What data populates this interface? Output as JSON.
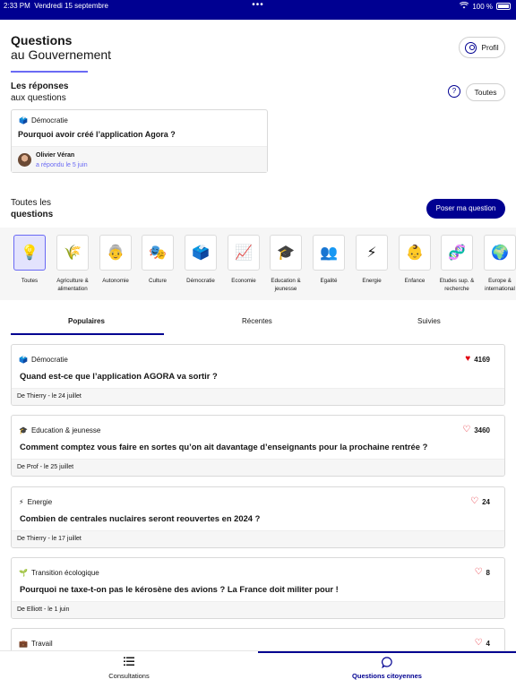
{
  "status_bar": {
    "time": "2:33 PM",
    "date": "Vendredi 15 septembre",
    "dots": "•••",
    "battery": "100 %"
  },
  "header": {
    "title_line1": "Questions",
    "title_line2": "au Gouvernement",
    "profile_label": "Profil"
  },
  "responses": {
    "title_line1": "Les réponses",
    "title_line2": "aux questions",
    "all_label": "Toutes",
    "card": {
      "category_icon": "🗳️",
      "category": "Démocratie",
      "question": "Pourquoi avoir créé l’application Agora ?",
      "author": "Olivier Véran",
      "answered": "a répondu le 5 juin"
    }
  },
  "questions_section": {
    "title_line1": "Toutes les",
    "title_line2": "questions",
    "ask_button": "Poser ma question"
  },
  "categories": [
    {
      "icon": "💡",
      "label": "Toutes"
    },
    {
      "icon": "🌾",
      "label": "Agriculture & alimentation"
    },
    {
      "icon": "👵",
      "label": "Autonomie"
    },
    {
      "icon": "🎭",
      "label": "Culture"
    },
    {
      "icon": "🗳️",
      "label": "Démocratie"
    },
    {
      "icon": "📈",
      "label": "Economie"
    },
    {
      "icon": "🎓",
      "label": "Education & jeunesse"
    },
    {
      "icon": "👥",
      "label": "Egalité"
    },
    {
      "icon": "⚡",
      "label": "Energie"
    },
    {
      "icon": "👶",
      "label": "Enfance"
    },
    {
      "icon": "🧬",
      "label": "Etudes sup. & recherche"
    },
    {
      "icon": "🌍",
      "label": "Europe & international"
    }
  ],
  "tabs": {
    "popular": "Populaires",
    "recent": "Récentes",
    "followed": "Suivies"
  },
  "questions": [
    {
      "icon": "🗳️",
      "category": "Démocratie",
      "likes": "4169",
      "liked": true,
      "question": "Quand est-ce que l’application AGORA va sortir ?",
      "footer": "De Thierry - le 24 juillet"
    },
    {
      "icon": "🎓",
      "category": "Education & jeunesse",
      "likes": "3460",
      "liked": false,
      "question": "Comment comptez vous faire en sortes qu’on ait davantage d’enseignants pour la prochaine rentrée ?",
      "footer": "De Prof - le 25 juillet"
    },
    {
      "icon": "⚡",
      "category": "Energie",
      "likes": "24",
      "liked": false,
      "question": "Combien de centrales nuclaires seront reouvertes en 2024 ?",
      "footer": "De Thierry - le 17 juillet"
    },
    {
      "icon": "🌱",
      "category": "Transition écologique",
      "likes": "8",
      "liked": false,
      "question": "Pourquoi ne taxe-t-on pas le kérosène des avions ? La France doit militer pour !",
      "footer": "De Elliott - le 1 juin"
    },
    {
      "icon": "💼",
      "category": "Travail",
      "likes": "4",
      "liked": false,
      "question": "",
      "footer": ""
    }
  ],
  "bottom_nav": {
    "consultations": "Consultations",
    "citizen_questions": "Questions citoyennes"
  }
}
